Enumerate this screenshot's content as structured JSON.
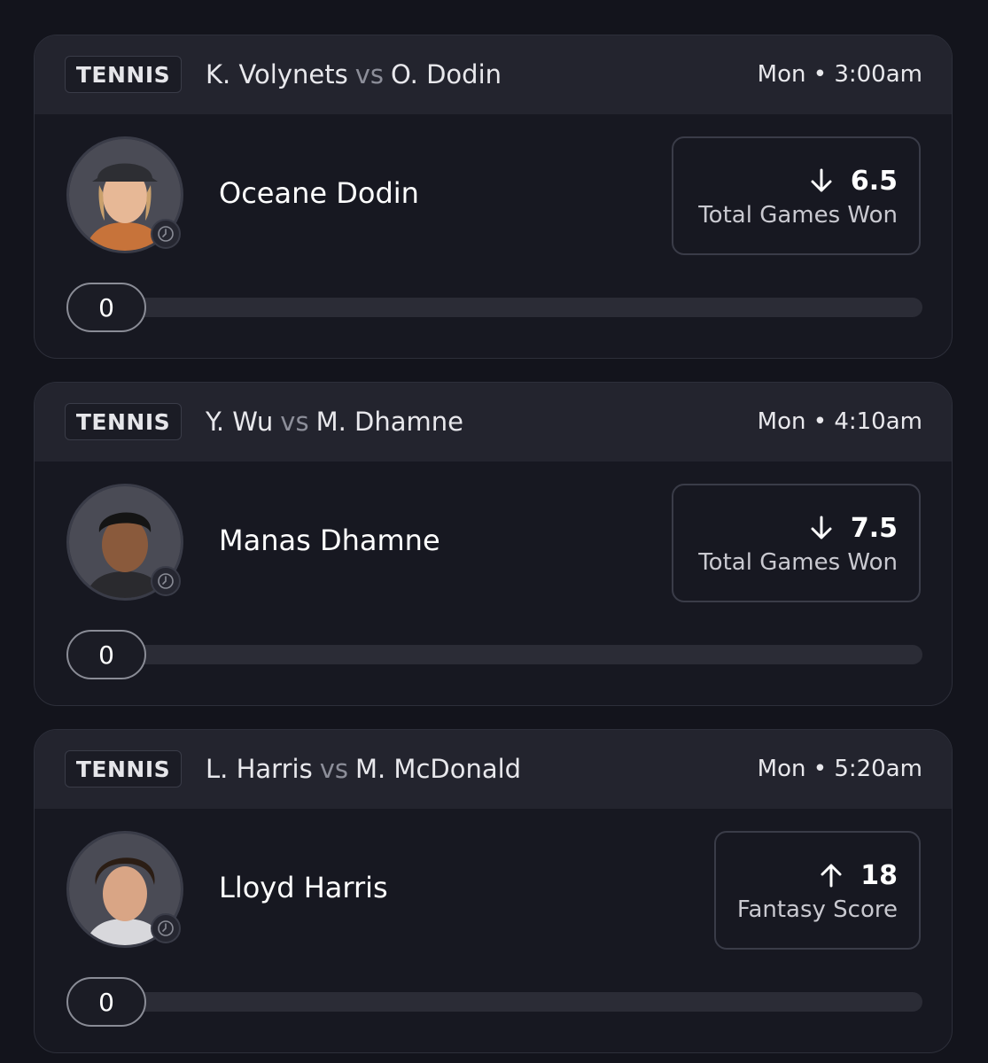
{
  "cards": [
    {
      "sport": "TENNIS",
      "player1": "K. Volynets",
      "vs": "vs",
      "player2": "O. Dodin",
      "time": "Mon • 3:00am",
      "player_name": "Oceane Dodin",
      "direction": "down",
      "line": "6.5",
      "stat": "Total Games Won",
      "progress_value": "0",
      "progress_fraction": 0
    },
    {
      "sport": "TENNIS",
      "player1": "Y. Wu",
      "vs": "vs",
      "player2": "M. Dhamne",
      "time": "Mon • 4:10am",
      "player_name": "Manas Dhamne",
      "direction": "down",
      "line": "7.5",
      "stat": "Total Games Won",
      "progress_value": "0",
      "progress_fraction": 0
    },
    {
      "sport": "TENNIS",
      "player1": "L. Harris",
      "vs": "vs",
      "player2": "M. McDonald",
      "time": "Mon • 5:20am",
      "player_name": "Lloyd Harris",
      "direction": "up",
      "line": "18",
      "stat": "Fantasy Score",
      "progress_value": "0",
      "progress_fraction": 0
    }
  ],
  "colors": {
    "background": "#13141c",
    "card": "#171821",
    "header": "#23242e",
    "border": "#2d2f3a",
    "track": "#2b2c36"
  }
}
